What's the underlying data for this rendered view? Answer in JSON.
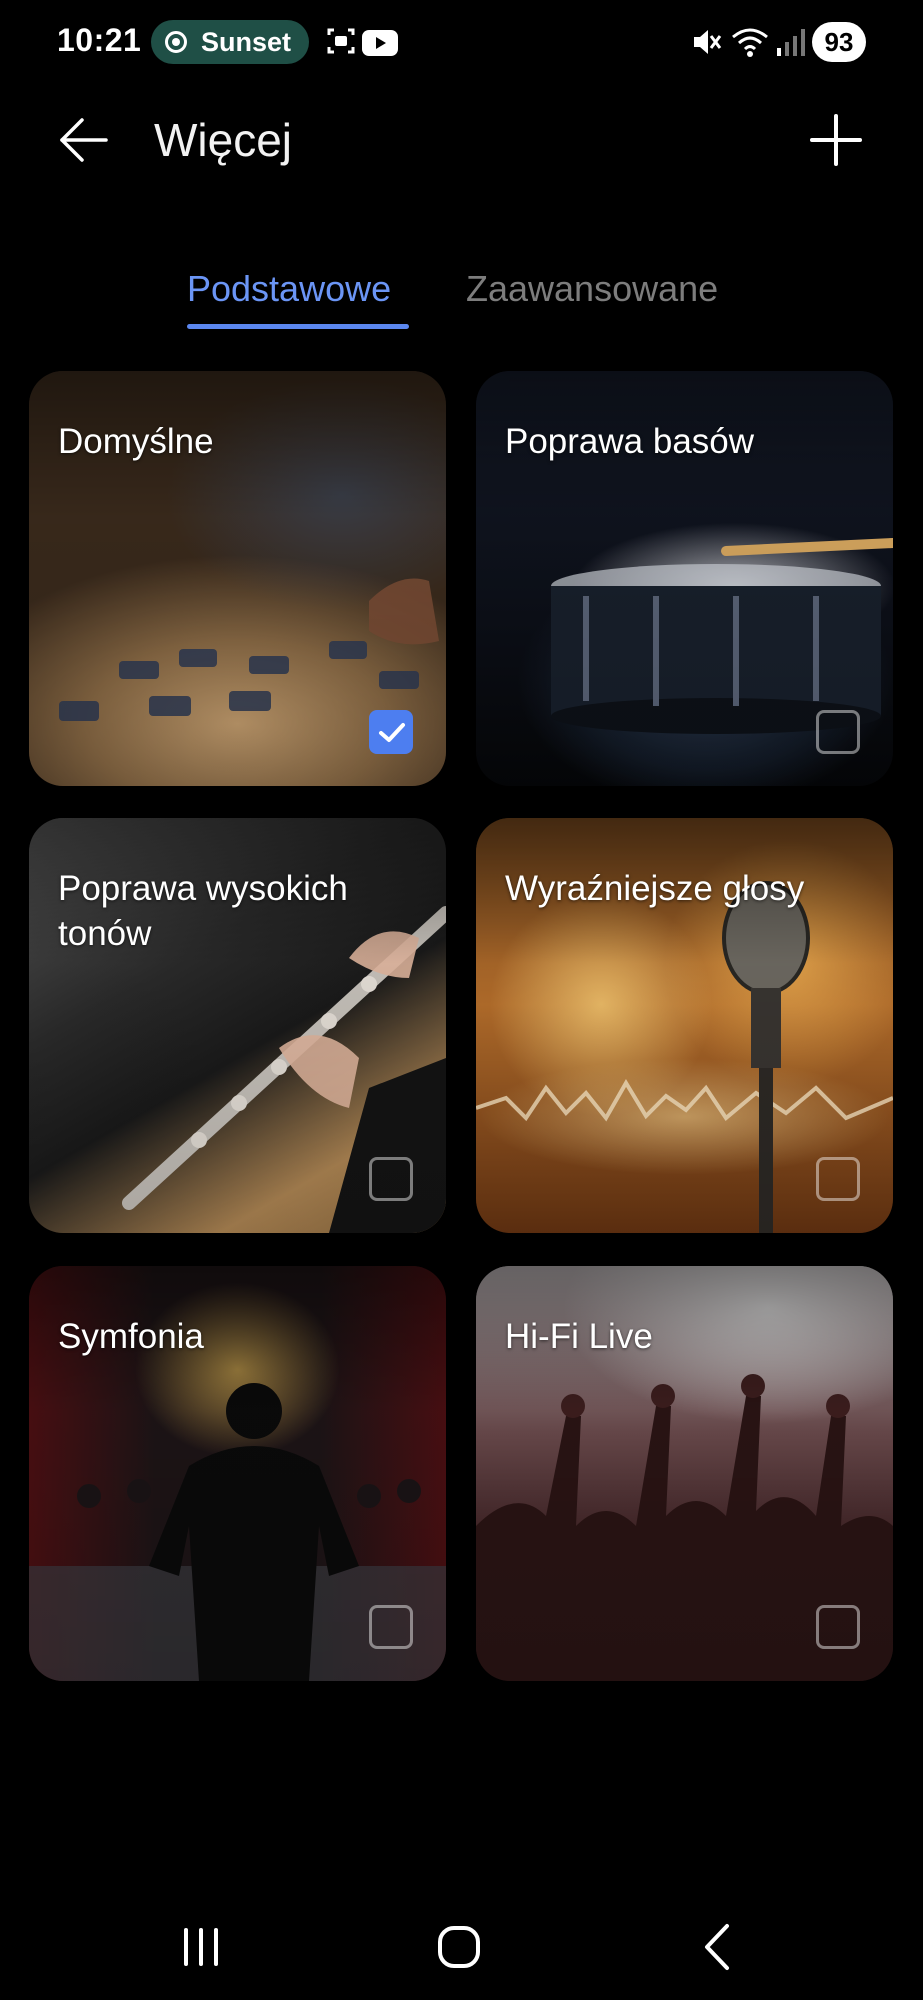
{
  "status_bar": {
    "time": "10:21",
    "recording_pill": "Sunset",
    "battery": "93",
    "icons": [
      "screen-capture-icon",
      "youtube-icon",
      "mute-icon",
      "wifi-icon",
      "signal-icon"
    ]
  },
  "header": {
    "title": "Więcej",
    "back_icon": "arrow-left-icon",
    "add_icon": "plus-icon"
  },
  "tabs": [
    {
      "label": "Podstawowe",
      "active": true
    },
    {
      "label": "Zaawansowane",
      "active": false
    }
  ],
  "presets": [
    {
      "label": "Domyślne",
      "selected": true
    },
    {
      "label": "Poprawa basów",
      "selected": false
    },
    {
      "label": "Poprawa wysokich tonów",
      "selected": false
    },
    {
      "label": "Wyraźniejsze głosy",
      "selected": false
    },
    {
      "label": "Symfonia",
      "selected": false
    },
    {
      "label": "Hi-Fi Live",
      "selected": false
    }
  ],
  "colors": {
    "accent": "#5b87ef",
    "checkbox_on": "#4d7ef0",
    "pill_bg": "#1f4f46",
    "inactive_tab": "#7d7d7d"
  },
  "nav": [
    "recents-icon",
    "home-icon",
    "back-icon"
  ]
}
